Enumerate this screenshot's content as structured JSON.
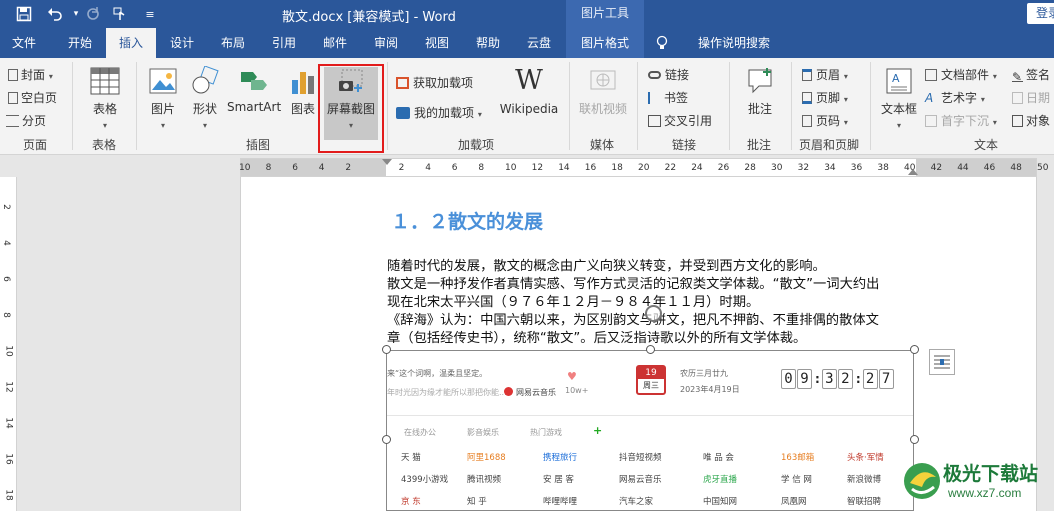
{
  "titlebar": {
    "doc_title": "散文.docx [兼容模式]  -  Word",
    "context_group": "图片工具",
    "login": "登录"
  },
  "tabs": [
    "文件",
    "开始",
    "插入",
    "设计",
    "布局",
    "引用",
    "邮件",
    "审阅",
    "视图",
    "帮助",
    "云盘",
    "图片格式"
  ],
  "active_tab": "插入",
  "tell_me": "操作说明搜索",
  "ribbon": {
    "pages": {
      "cover": "封面",
      "blank": "空白页",
      "break": "分页",
      "label": "页面"
    },
    "tables": {
      "table": "表格",
      "label": "表格"
    },
    "illustrations": {
      "picture": "图片",
      "shapes": "形状",
      "smartart": "SmartArt",
      "chart": "图表",
      "screenshot": "屏幕截图",
      "label": "插图"
    },
    "addins": {
      "get": "获取加载项",
      "my": "我的加载项",
      "wikipedia": "Wikipedia",
      "label": "加载项"
    },
    "media": {
      "online_video": "联机视频",
      "label": "媒体"
    },
    "links": {
      "link": "链接",
      "bookmark": "书签",
      "cross_ref": "交叉引用",
      "label": "链接"
    },
    "comments": {
      "comment": "批注",
      "label": "批注"
    },
    "header_footer": {
      "header": "页眉",
      "footer": "页脚",
      "page_number": "页码",
      "label": "页眉和页脚"
    },
    "text": {
      "textbox": "文本框",
      "quick_parts": "文档部件",
      "wordart": "艺术字",
      "dropcap": "首字下沉",
      "signature": "签名",
      "date": "日期",
      "object": "对象",
      "label": "文本"
    }
  },
  "ruler": {
    "numbers": [
      "10",
      "8",
      "6",
      "4",
      "2",
      "",
      "2",
      "4",
      "6",
      "8",
      "10",
      "12",
      "14",
      "16",
      "18",
      "20",
      "22",
      "24",
      "26",
      "28",
      "30",
      "32",
      "34",
      "36",
      "38",
      "40",
      "42",
      "44",
      "46",
      "48",
      "50"
    ]
  },
  "vruler": {
    "numbers": [
      "2",
      "4",
      "6",
      "8",
      "10",
      "12",
      "14",
      "16",
      "18"
    ]
  },
  "document": {
    "heading": "１．２散文的发展",
    "paragraphs": [
      "随着时代的发展，散文的概念由广义向狭义转变，并受到西方文化的影响。",
      "散文是一种抒发作者真情实感、写作方式灵活的记叙类文学体裁。“散文”一词大约出",
      "现在北宋太平兴国（９７６年１２月－９８４年１１月）时期。",
      "《辞海》认为：中国六朝以来，为区别韵文与骈文，把凡不押韵、不重排偶的散体文",
      "章（包括经传史书），统称“散文”。后又泛指诗歌以外的所有文学体裁。"
    ]
  },
  "inserted_image": {
    "quote": "来“这个词啊，温柔且坚定。",
    "subline": "年时光因为缘才能所以那把你能...",
    "music": "网易云音乐",
    "likes": "10w+",
    "cal_day": "19",
    "cal_week": "周三",
    "lunar": "农历三月廿九",
    "date": "2023年4月19日",
    "time": [
      "0",
      "9",
      "3",
      "2",
      "2",
      "7"
    ],
    "tabs": [
      "在线办公",
      "影音娱乐",
      "热门游戏",
      "+"
    ],
    "links_row1": [
      "天 猫",
      "阿里1688",
      "携程旅行",
      "抖音短视频",
      "唯 品 会",
      "163邮箱",
      "头条·军情"
    ],
    "links_row2": [
      "4399小游戏",
      "腾讯视频",
      "安 居 客",
      "网易云音乐",
      "虎牙直播",
      "学 信 网",
      "新浪微博"
    ],
    "links_row3": [
      "京 东",
      "知 乎",
      "哔哩哔哩",
      "汽车之家",
      "中国知网",
      "凤凰网",
      "智联招聘"
    ]
  },
  "watermark": {
    "title": "极光下载站",
    "url": "www.xz7.com"
  },
  "colors": {
    "title_bar": "#2b579a",
    "highlight": "#e21b1b",
    "heading": "#4a90d9"
  }
}
